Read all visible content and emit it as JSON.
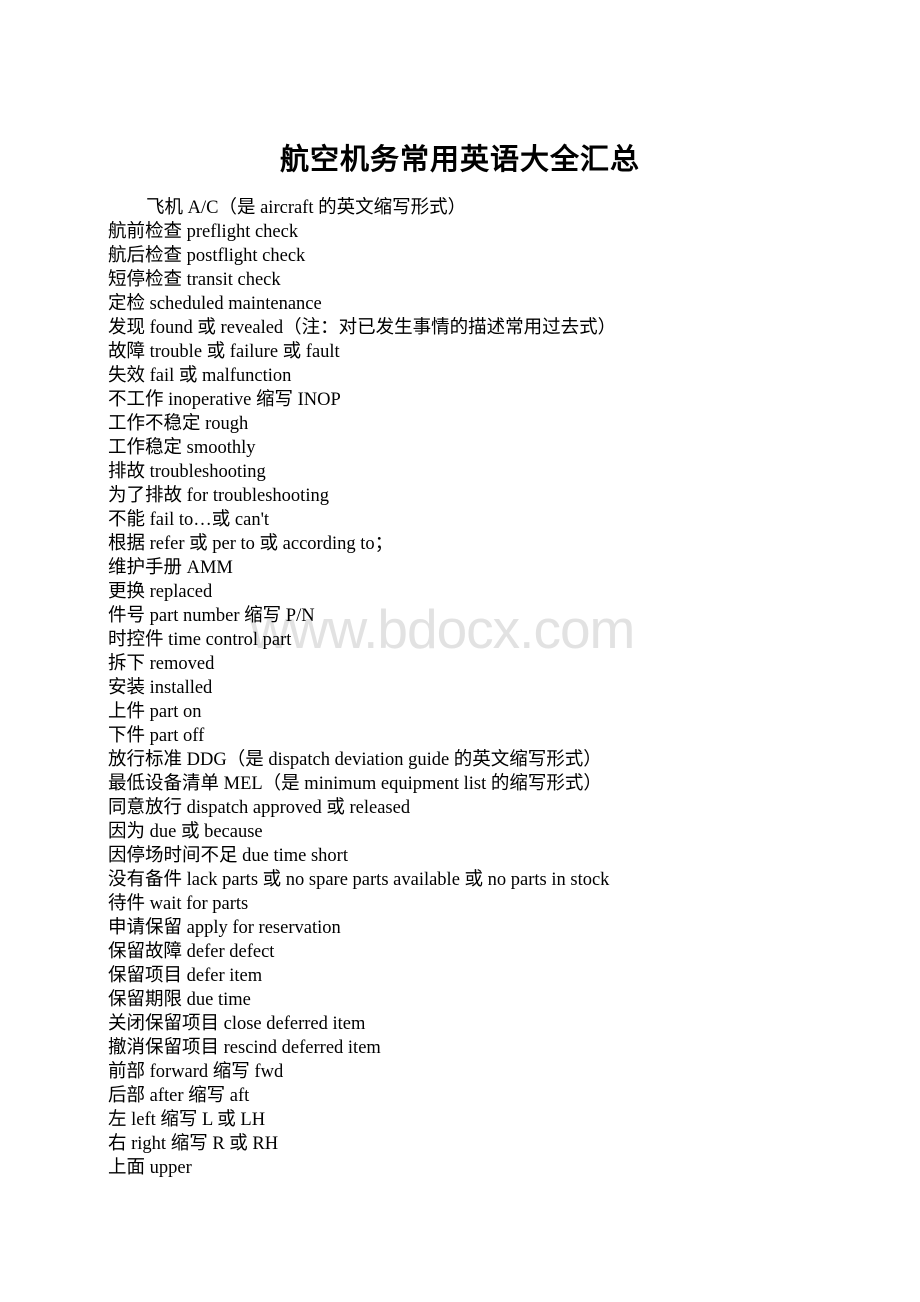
{
  "document": {
    "title": "航空机务常用英语大全汇总",
    "watermark": "www.bdocx.com",
    "entries": [
      {
        "text": "飞机      A/C（是 aircraft 的英文缩写形式）",
        "indented": true
      },
      {
        "text": "航前检查       preflight check",
        "indented": false
      },
      {
        "text": "航后检查    postflight check",
        "indented": false
      },
      {
        "text": "短停检查    transit   check",
        "indented": false
      },
      {
        "text": "定检    scheduled   maintenance",
        "indented": false
      },
      {
        "text": "发现   found 或 revealed（注：对已发生事情的描述常用过去式）",
        "indented": false
      },
      {
        "text": "故障   trouble 或 failure 或 fault",
        "indented": false
      },
      {
        "text": "失效   fail 或 malfunction",
        "indented": false
      },
      {
        "text": "不工作   inoperative 缩写 INOP",
        "indented": false
      },
      {
        "text": "工作不稳定   rough",
        "indented": false
      },
      {
        "text": "工作稳定   smoothly",
        "indented": false
      },
      {
        "text": "排故   troubleshooting",
        "indented": false
      },
      {
        "text": "为了排故   for troubleshooting",
        "indented": false
      },
      {
        "text": "不能   fail to…或 can't",
        "indented": false
      },
      {
        "text": "根据   refer 或 per to 或 according to；",
        "indented": false
      },
      {
        "text": "维护手册   AMM",
        "indented": false
      },
      {
        "text": "更换   replaced",
        "indented": false
      },
      {
        "text": "件号   part number 缩写 P/N",
        "indented": false
      },
      {
        "text": "时控件   time control part",
        "indented": false
      },
      {
        "text": "拆下   removed",
        "indented": false
      },
      {
        "text": "安装   installed",
        "indented": false
      },
      {
        "text": "上件   part on",
        "indented": false
      },
      {
        "text": "下件   part off",
        "indented": false
      },
      {
        "text": "放行标准   DDG（是 dispatch deviation guide 的英文缩写形式）",
        "indented": false
      },
      {
        "text": "最低设备清单   MEL（是 minimum equipment list 的缩写形式）",
        "indented": false
      },
      {
        "text": "同意放行   dispatch approved 或 released",
        "indented": false
      },
      {
        "text": "因为   due 或 because",
        "indented": false
      },
      {
        "text": "因停场时间不足   due time short",
        "indented": false
      },
      {
        "text": "没有备件   lack   parts 或 no spare parts available 或 no parts in stock",
        "indented": false
      },
      {
        "text": "待件   wait for parts",
        "indented": false
      },
      {
        "text": "申请保留   apply for reservation",
        "indented": false
      },
      {
        "text": "保留故障   defer defect",
        "indented": false
      },
      {
        "text": "保留项目   defer item",
        "indented": false
      },
      {
        "text": "保留期限   due time",
        "indented": false
      },
      {
        "text": "关闭保留项目   close deferred item",
        "indented": false
      },
      {
        "text": "撤消保留项目   rescind deferred item",
        "indented": false
      },
      {
        "text": "前部   forward 缩写 fwd",
        "indented": false
      },
      {
        "text": "后部   after 缩写 aft",
        "indented": false
      },
      {
        "text": "左     left 缩写 L 或 LH",
        "indented": false
      },
      {
        "text": "右     right 缩写 R 或 RH",
        "indented": false
      },
      {
        "text": "上面   upper",
        "indented": false
      }
    ]
  }
}
